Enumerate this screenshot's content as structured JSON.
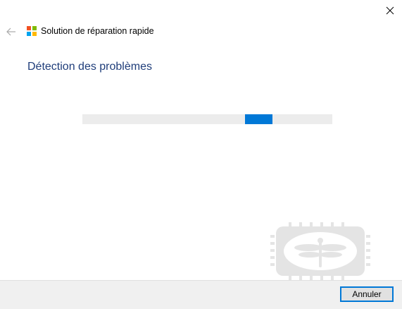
{
  "window": {
    "title": "Solution de réparation rapide",
    "close_icon": "close-icon",
    "back_icon": "back-arrow-icon",
    "logo_icon": "windows-logo-icon",
    "logo_colors": [
      "#f25022",
      "#7fba00",
      "#00a4ef",
      "#ffb900"
    ]
  },
  "main": {
    "heading": "Détection des problèmes",
    "heading_color": "#1f3d7a",
    "progress": {
      "state": "indeterminate",
      "position": 0.73,
      "accent_color": "#0078d7"
    }
  },
  "footer": {
    "cancel_label": "Annuler"
  }
}
